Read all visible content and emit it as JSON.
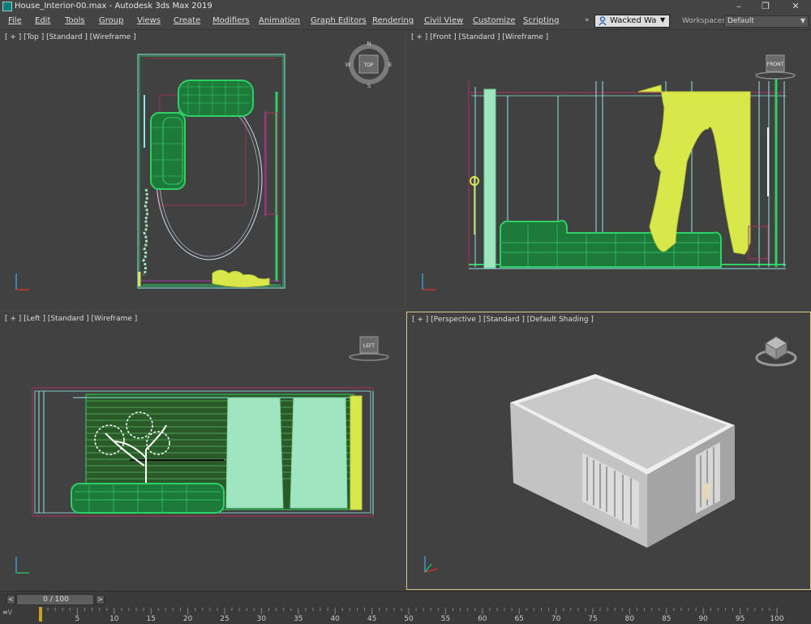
{
  "window": {
    "title": "House_Interior-00.max - Autodesk 3ds Max 2019",
    "minimize": "–",
    "maximize": "❐",
    "close": "✕"
  },
  "menu": [
    {
      "label": "File"
    },
    {
      "label": "Edit"
    },
    {
      "label": "Tools"
    },
    {
      "label": "Group"
    },
    {
      "label": "Views"
    },
    {
      "label": "Create"
    },
    {
      "label": "Modifiers"
    },
    {
      "label": "Animation"
    },
    {
      "label": "Graph Editors"
    },
    {
      "label": "Rendering"
    },
    {
      "label": "Civil View"
    },
    {
      "label": "Customize"
    },
    {
      "label": "Scripting"
    }
  ],
  "menu_more": "»",
  "user": {
    "name": "Wacked Wa",
    "caret": "▼",
    "icon": "user-icon"
  },
  "workspace": {
    "label": "Workspaces:",
    "value": "Default",
    "caret": "▼"
  },
  "viewports": {
    "top": {
      "label": "[ + ] [Top ] [Standard ] [Wireframe ]",
      "cube_label": "TOP",
      "compass": [
        "N",
        "E",
        "S",
        "W"
      ]
    },
    "front": {
      "label": "[ + ] [Front ] [Standard ] [Wireframe ]",
      "cube_label": "FRONT"
    },
    "left": {
      "label": "[ + ] [Left ] [Standard ] [Wireframe ]",
      "cube_label": "LEFT"
    },
    "perspective": {
      "label": "[ + ] [Perspective ] [Standard ] [Default Shading ]"
    }
  },
  "colors": {
    "viewport_bg": "#414141",
    "active_border": "#d6c88a",
    "wire_green": "#2fd066",
    "wire_yellow": "#d8e74a",
    "wire_mint": "#9fe6c0",
    "wire_cyan": "#8fe6e6",
    "wire_red": "#b0305a",
    "wire_purple": "#a035a0"
  },
  "timeline": {
    "frame_display": "0 / 100",
    "prev_label": "<",
    "next_label": ">",
    "ruler_icon": "≡\\/",
    "ticks": [
      5,
      10,
      15,
      20,
      25,
      30,
      35,
      40,
      45,
      50,
      55,
      60,
      65,
      70,
      75,
      80,
      85,
      90,
      95,
      100
    ]
  }
}
